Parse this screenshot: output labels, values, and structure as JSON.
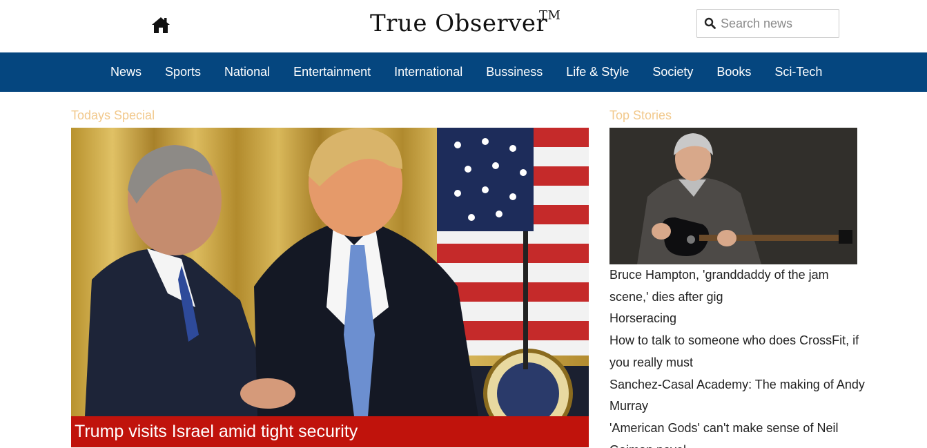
{
  "header": {
    "brand": "True Observer",
    "trademark": "TM",
    "search_placeholder": "Search news"
  },
  "nav": {
    "items": [
      "News",
      "Sports",
      "National",
      "Entertainment",
      "International",
      "Bussiness",
      "Life & Style",
      "Society",
      "Books",
      "Sci-Tech"
    ]
  },
  "todays_special": {
    "label": "Todays Special",
    "headline": "Trump visits Israel amid tight security"
  },
  "top_stories": {
    "label": "Top Stories",
    "items": [
      "Bruce Hampton, 'granddaddy of the jam scene,' dies after gig",
      "Horseracing",
      "How to talk to someone who does CrossFit, if you really must",
      "Sanchez-Casal Academy: The making of Andy Murray",
      "'American Gods' can't make sense of Neil Gaiman novel"
    ]
  },
  "colors": {
    "nav_bg": "#05467f",
    "caption_bg": "#c0130c",
    "section_label": "#f2c98d"
  },
  "icons": [
    "home-icon",
    "search-icon"
  ]
}
